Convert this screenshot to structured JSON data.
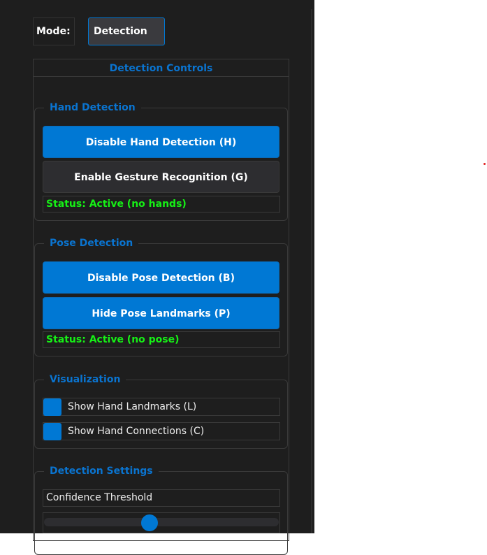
{
  "mode": {
    "label": "Mode:",
    "value": "Detection"
  },
  "panel_title": "Detection Controls",
  "hand": {
    "title": "Hand Detection",
    "disable_button": "Disable Hand Detection (H)",
    "gesture_button": "Enable Gesture Recognition (G)",
    "status": "Status: Active (no hands)"
  },
  "pose": {
    "title": "Pose Detection",
    "disable_button": "Disable Pose Detection (B)",
    "landmarks_button": "Hide Pose Landmarks (P)",
    "status": "Status: Active (no pose)"
  },
  "visualization": {
    "title": "Visualization",
    "show_landmarks": "Show Hand Landmarks (L)",
    "show_connections": "Show Hand Connections (C)",
    "landmarks_checked": true,
    "connections_checked": true
  },
  "settings": {
    "title": "Detection Settings",
    "confidence_label": "Confidence Threshold",
    "confidence_value": 0.45
  },
  "colors": {
    "accent": "#0078d4",
    "status": "#16f016",
    "background": "#1e1e1e"
  }
}
